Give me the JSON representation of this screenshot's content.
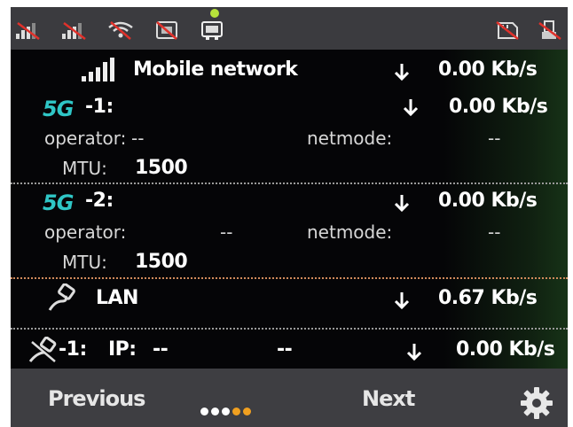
{
  "status_bar": {
    "icons": [
      "no-signal-icon",
      "no-signal-icon",
      "no-wifi-icon",
      "no-sim-icon",
      "sim-icon",
      "no-sd-card-icon",
      "no-usb-icon"
    ]
  },
  "mobile_network": {
    "title": "Mobile network",
    "rate": "0.00 Kb/s",
    "icon": "signal-bars-icon"
  },
  "modem1": {
    "badge": "5G",
    "name": "-1:",
    "rate": "0.00 Kb/s",
    "operator_label": "operator:",
    "operator_value": "--",
    "netmode_label": "netmode:",
    "netmode_value": "--",
    "mtu_label": "MTU:",
    "mtu_value": "1500"
  },
  "modem2": {
    "badge": "5G",
    "name": "-2:",
    "rate": "0.00 Kb/s",
    "operator_label": "operator:",
    "operator_value": "--",
    "netmode_label": "netmode:",
    "netmode_value": "--",
    "mtu_label": "MTU:",
    "mtu_value": "1500"
  },
  "lan": {
    "label": "LAN",
    "rate": "0.67 Kb/s",
    "icon": "ethernet-icon"
  },
  "lan1": {
    "name": "-1:",
    "ip_label": "IP:",
    "ip_value": "--",
    "extra_value": "--",
    "rate": "0.00 Kb/s",
    "icon": "ethernet-disconnected-icon"
  },
  "bottom_bar": {
    "previous_label": "Previous",
    "next_label": "Next",
    "page_count": 5,
    "active_pages": [
      3,
      4
    ],
    "settings_icon": "gear-icon"
  },
  "colors": {
    "accent_5g": "#2fc6c6",
    "pager_active": "#f0a020",
    "status_dot": "#b7e23b"
  }
}
